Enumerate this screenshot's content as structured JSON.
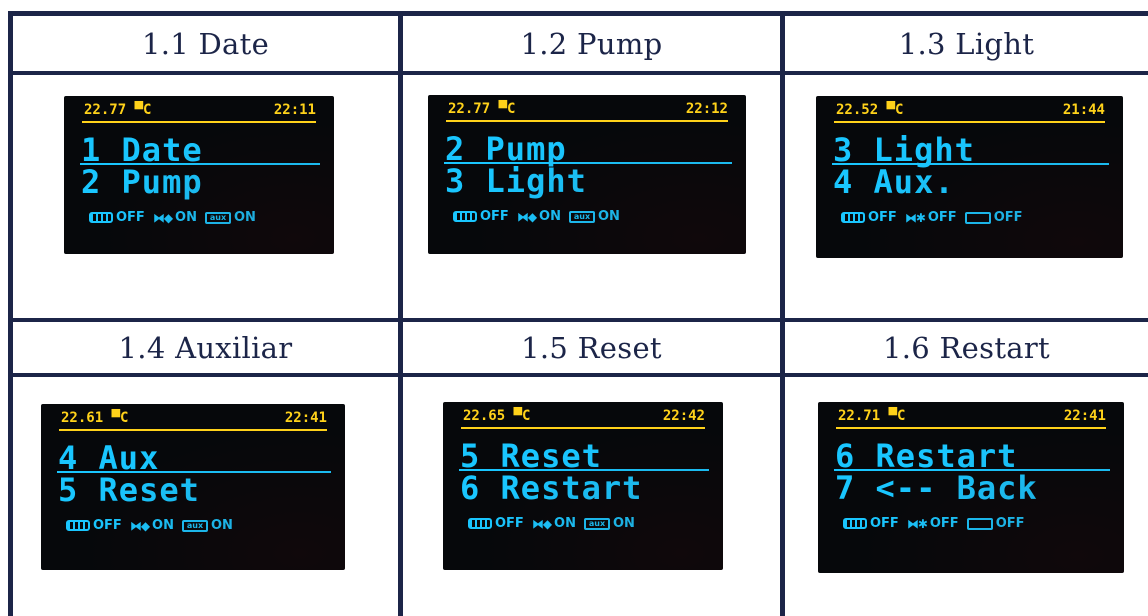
{
  "headers": [
    "1.1  Date",
    "1.2  Pump",
    "1.3 Light",
    "1.4 Auxiliar",
    "1.5 Reset",
    "1.6 Restart"
  ],
  "panels": [
    {
      "temp": "22.77 ▀C",
      "time": "22:11",
      "line1": "1 Date",
      "line2": "2 Pump",
      "fan": "OFF",
      "pump": "ON",
      "aux_icon": "aux",
      "aux": "ON"
    },
    {
      "temp": "22.77 ▀C",
      "time": "22:12",
      "line1": "2 Pump",
      "line2": "3 Light",
      "fan": "OFF",
      "pump": "ON",
      "aux_icon": "aux",
      "aux": "ON"
    },
    {
      "temp": "22.52 ▀C",
      "time": "21:44",
      "line1": "3 Light",
      "line2": "4 Aux.",
      "fan": "OFF",
      "pump": "OFF",
      "aux_icon": "",
      "aux": "OFF"
    },
    {
      "temp": "22.61 ▀C",
      "time": "22:41",
      "line1": "4 Aux",
      "line2": "5 Reset",
      "fan": "OFF",
      "pump": "ON",
      "aux_icon": "aux",
      "aux": "ON"
    },
    {
      "temp": "22.65 ▀C",
      "time": "22:42",
      "line1": "5 Reset",
      "line2": "6 Restart",
      "fan": "OFF",
      "pump": "ON",
      "aux_icon": "aux",
      "aux": "ON"
    },
    {
      "temp": "22.71 ▀C",
      "time": "22:41",
      "line1": "6 Restart",
      "line2": "7 <-- Back",
      "fan": "OFF",
      "pump": "OFF",
      "aux_icon": "",
      "aux": "OFF"
    }
  ],
  "icons": {
    "fan": "fan-icon",
    "pump": "pump-icon",
    "aux": "aux-box-icon"
  },
  "colors": {
    "border": "#1c2548",
    "oled_yellow": "#ffd21a",
    "oled_cyan": "#19c6ff",
    "oled_bg": "#06080b"
  }
}
